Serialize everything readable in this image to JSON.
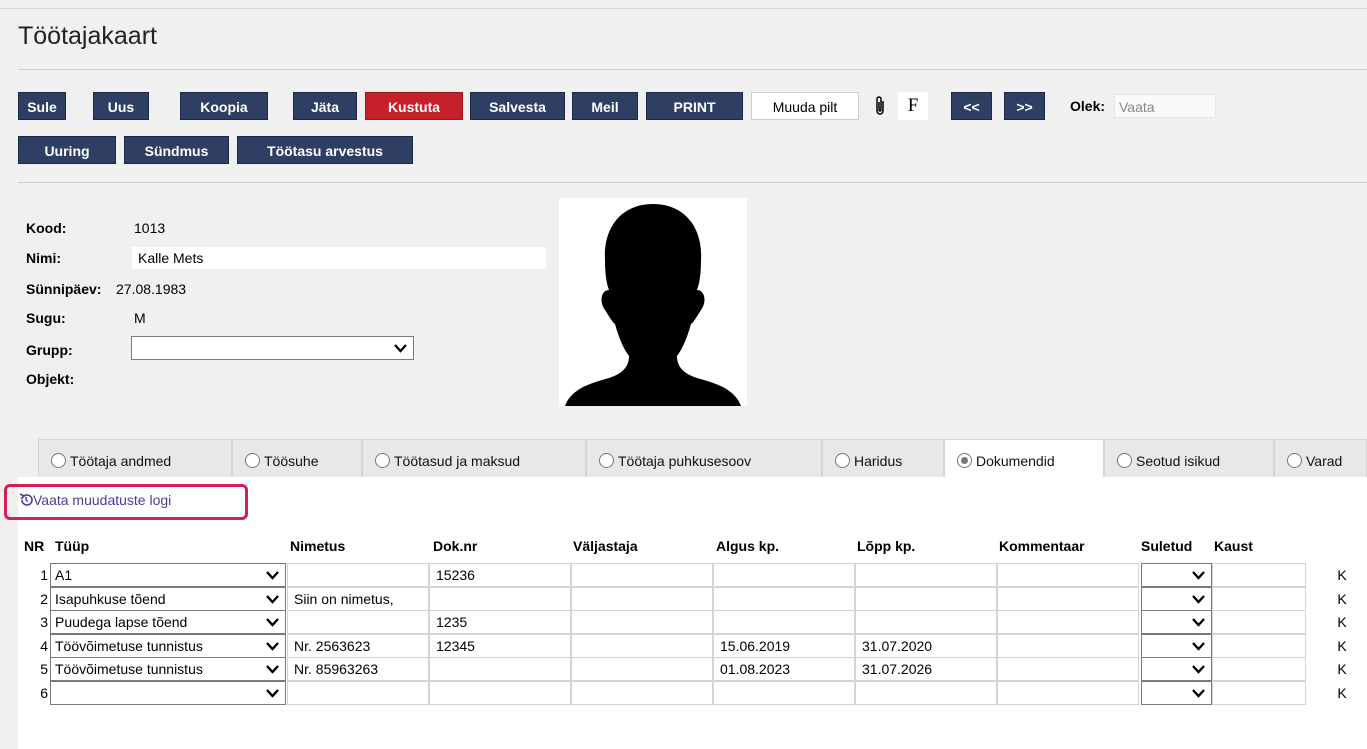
{
  "page": {
    "title": "Töötajakaart"
  },
  "toolbar": {
    "sule": "Sule",
    "uus": "Uus",
    "koopia": "Koopia",
    "jata": "Jäta",
    "kustuta": "Kustuta",
    "salvesta": "Salvesta",
    "meil": "Meil",
    "print": "PRINT",
    "muuda_pilt": "Muuda pilt",
    "attach_icon": "paperclip-icon",
    "f_label": "F",
    "prev": "<<",
    "next": ">>",
    "olek_label": "Olek:",
    "olek_value": "Vaata",
    "uuring": "Uuring",
    "sundmus": "Sündmus",
    "tootasu": "Töötasu arvestus"
  },
  "header": {
    "kood_label": "Kood:",
    "kood_value": "1013",
    "nimi_label": "Nimi:",
    "nimi_value": "Kalle Mets",
    "synnipaev_label": "Sünnipäev:",
    "synnipaev_value": "27.08.1983",
    "sugu_label": "Sugu:",
    "sugu_value": "M",
    "grupp_label": "Grupp:",
    "grupp_value": "",
    "objekt_label": "Objekt:"
  },
  "tabs": [
    {
      "label": "Töötaja andmed",
      "active": false
    },
    {
      "label": "Töösuhe",
      "active": false
    },
    {
      "label": "Töötasud ja maksud",
      "active": false
    },
    {
      "label": "Töötaja puhkusesoov",
      "active": false
    },
    {
      "label": "Haridus",
      "active": false
    },
    {
      "label": "Dokumendid",
      "active": true
    },
    {
      "label": "Seotud isikud",
      "active": false
    },
    {
      "label": "Varad",
      "active": false
    }
  ],
  "log_link": {
    "icon": "history-icon",
    "label": "Vaata muudatuste logi"
  },
  "table": {
    "headers": {
      "nr": "NR",
      "tyyp": "Tüüp",
      "nimetus": "Nimetus",
      "doknr": "Dok.nr",
      "valjastaja": "Väljastaja",
      "algus": "Algus kp.",
      "lopp": "Lõpp kp.",
      "kommentaar": "Kommentaar",
      "suletud": "Suletud",
      "kaust": "Kaust"
    },
    "k_label": "K",
    "rows": [
      {
        "nr": "1",
        "tyyp": "A1",
        "nimetus": "",
        "doknr": "15236",
        "valjastaja": "",
        "algus": "",
        "lopp": "",
        "kommentaar": "",
        "suletud": "",
        "kaust": ""
      },
      {
        "nr": "2",
        "tyyp": "Isapuhkuse tõend",
        "nimetus": "Siin on nimetus,",
        "doknr": "",
        "valjastaja": "",
        "algus": "",
        "lopp": "",
        "kommentaar": "",
        "suletud": "",
        "kaust": ""
      },
      {
        "nr": "3",
        "tyyp": "Puudega lapse tõend",
        "nimetus": "",
        "doknr": "1235",
        "valjastaja": "",
        "algus": "",
        "lopp": "",
        "kommentaar": "",
        "suletud": "",
        "kaust": ""
      },
      {
        "nr": "4",
        "tyyp": "Töövõimetuse tunnistus",
        "nimetus": "Nr. 2563623",
        "doknr": "12345",
        "valjastaja": "",
        "algus": "15.06.2019",
        "lopp": "31.07.2020",
        "kommentaar": "",
        "suletud": "",
        "kaust": ""
      },
      {
        "nr": "5",
        "tyyp": "Töövõimetuse tunnistus",
        "nimetus": "Nr. 85963263",
        "doknr": "",
        "valjastaja": "",
        "algus": "01.08.2023",
        "lopp": "31.07.2026",
        "kommentaar": "",
        "suletud": "",
        "kaust": ""
      },
      {
        "nr": "6",
        "tyyp": "",
        "nimetus": "",
        "doknr": "",
        "valjastaja": "",
        "algus": "",
        "lopp": "",
        "kommentaar": "",
        "suletud": "",
        "kaust": ""
      }
    ]
  }
}
